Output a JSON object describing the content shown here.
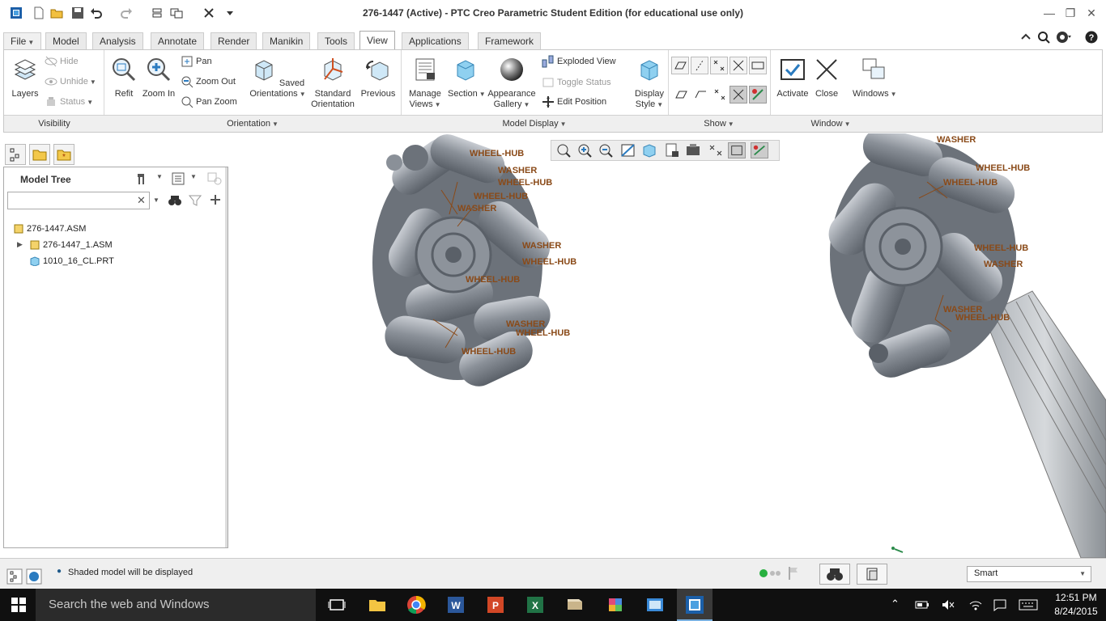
{
  "window": {
    "title": "276-1447 (Active) - PTC Creo Parametric Student Edition (for educational use only)"
  },
  "tabs": [
    {
      "label": "File",
      "active": false
    },
    {
      "label": "Model",
      "active": false
    },
    {
      "label": "Analysis",
      "active": false
    },
    {
      "label": "Annotate",
      "active": false
    },
    {
      "label": "Render",
      "active": false
    },
    {
      "label": "Manikin",
      "active": false
    },
    {
      "label": "Tools",
      "active": false
    },
    {
      "label": "View",
      "active": true
    },
    {
      "label": "Applications",
      "active": false
    },
    {
      "label": "Framework",
      "active": false
    }
  ],
  "ribbon": {
    "visibility": {
      "layers": "Layers",
      "hide": "Hide",
      "unhide": "Unhide",
      "status": "Status"
    },
    "orientation": {
      "refit": "Refit",
      "zoom_in": "Zoom In",
      "pan": "Pan",
      "zoom_out": "Zoom Out",
      "pan_zoom": "Pan Zoom",
      "saved_orientations_1": "Saved",
      "saved_orientations_2": "Orientations",
      "standard_orientation_1": "Standard",
      "standard_orientation_2": "Orientation",
      "previous": "Previous"
    },
    "model_display": {
      "manage_views_1": "Manage",
      "manage_views_2": "Views",
      "section": "Section",
      "appearance_gallery_1": "Appearance",
      "appearance_gallery_2": "Gallery",
      "exploded_view": "Exploded View",
      "toggle_status": "Toggle Status",
      "edit_position": "Edit Position",
      "display_style_1": "Display",
      "display_style_2": "Style"
    },
    "window": {
      "activate": "Activate",
      "close": "Close",
      "windows": "Windows"
    },
    "groups": {
      "visibility": "Visibility",
      "orientation": "Orientation",
      "model_display": "Model Display",
      "show": "Show",
      "window": "Window"
    }
  },
  "model_tree": {
    "title": "Model Tree",
    "search_placeholder": "",
    "items": [
      {
        "label": "276-1447.ASM"
      },
      {
        "label": "276-1447_1.ASM"
      },
      {
        "label": "1010_16_CL.PRT"
      }
    ]
  },
  "graphics": {
    "labels": [
      "WHEEL-HUB",
      "WASHER",
      "WHEEL-HUB",
      "WASHER",
      "WHEEL-HUB",
      "WHEEL-HUB",
      "WASHER",
      "WHEEL-HUB",
      "WASHER",
      "WHEEL-HUB",
      "WASHER",
      "WHEEL-HUB",
      "WHEEL-HUB",
      "WHEEL-HUB",
      "WASHER",
      "WHEEL-HUB",
      "WASHER",
      "WHEEL-HUB"
    ]
  },
  "statusbar": {
    "message": "Shaded model will be displayed",
    "filter": "Smart"
  },
  "taskbar": {
    "search": "Search the web and Windows",
    "time": "12:51 PM",
    "date": "8/24/2015"
  },
  "colors": {
    "label": "#8a4a18",
    "part": "#8c939c",
    "accent": "#1e88c8"
  }
}
